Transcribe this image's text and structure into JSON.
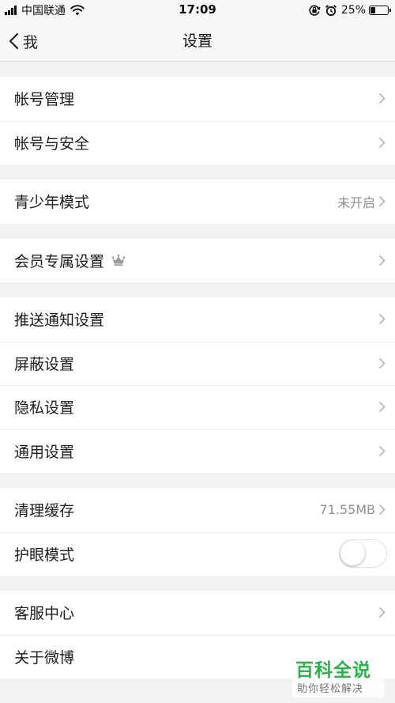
{
  "status_bar": {
    "carrier": "中国联通",
    "time": "17:09",
    "battery_percent": "25%",
    "battery_level": 0.25,
    "icons": [
      "signal-icon",
      "wifi-icon",
      "orientation-lock-icon",
      "alarm-icon",
      "battery-icon"
    ]
  },
  "nav": {
    "back_label": "我",
    "title": "设置"
  },
  "groups": [
    {
      "rows": [
        {
          "label": "帐号管理",
          "icon": "chevron-right-icon"
        },
        {
          "label": "帐号与安全",
          "icon": "chevron-right-icon"
        }
      ]
    },
    {
      "rows": [
        {
          "label": "青少年模式",
          "value": "未开启",
          "icon": "chevron-right-icon"
        }
      ]
    },
    {
      "rows": [
        {
          "label": "会员专属设置",
          "badge_icon": "crown-icon",
          "icon": "chevron-right-icon"
        }
      ]
    },
    {
      "rows": [
        {
          "label": "推送通知设置",
          "icon": "chevron-right-icon"
        },
        {
          "label": "屏蔽设置",
          "icon": "chevron-right-icon"
        },
        {
          "label": "隐私设置",
          "icon": "chevron-right-icon"
        },
        {
          "label": "通用设置",
          "icon": "chevron-right-icon"
        }
      ]
    },
    {
      "rows": [
        {
          "label": "清理缓存",
          "value": "71.55MB",
          "icon": "chevron-right-icon"
        },
        {
          "label": "护眼模式",
          "toggle_on": false
        }
      ]
    },
    {
      "rows": [
        {
          "label": "客服中心",
          "icon": "chevron-right-icon"
        },
        {
          "label": "关于微博"
        }
      ]
    }
  ],
  "watermark": {
    "title": "百科全说",
    "subtitle": "助你轻松解决",
    "color": "#2bb34a"
  }
}
